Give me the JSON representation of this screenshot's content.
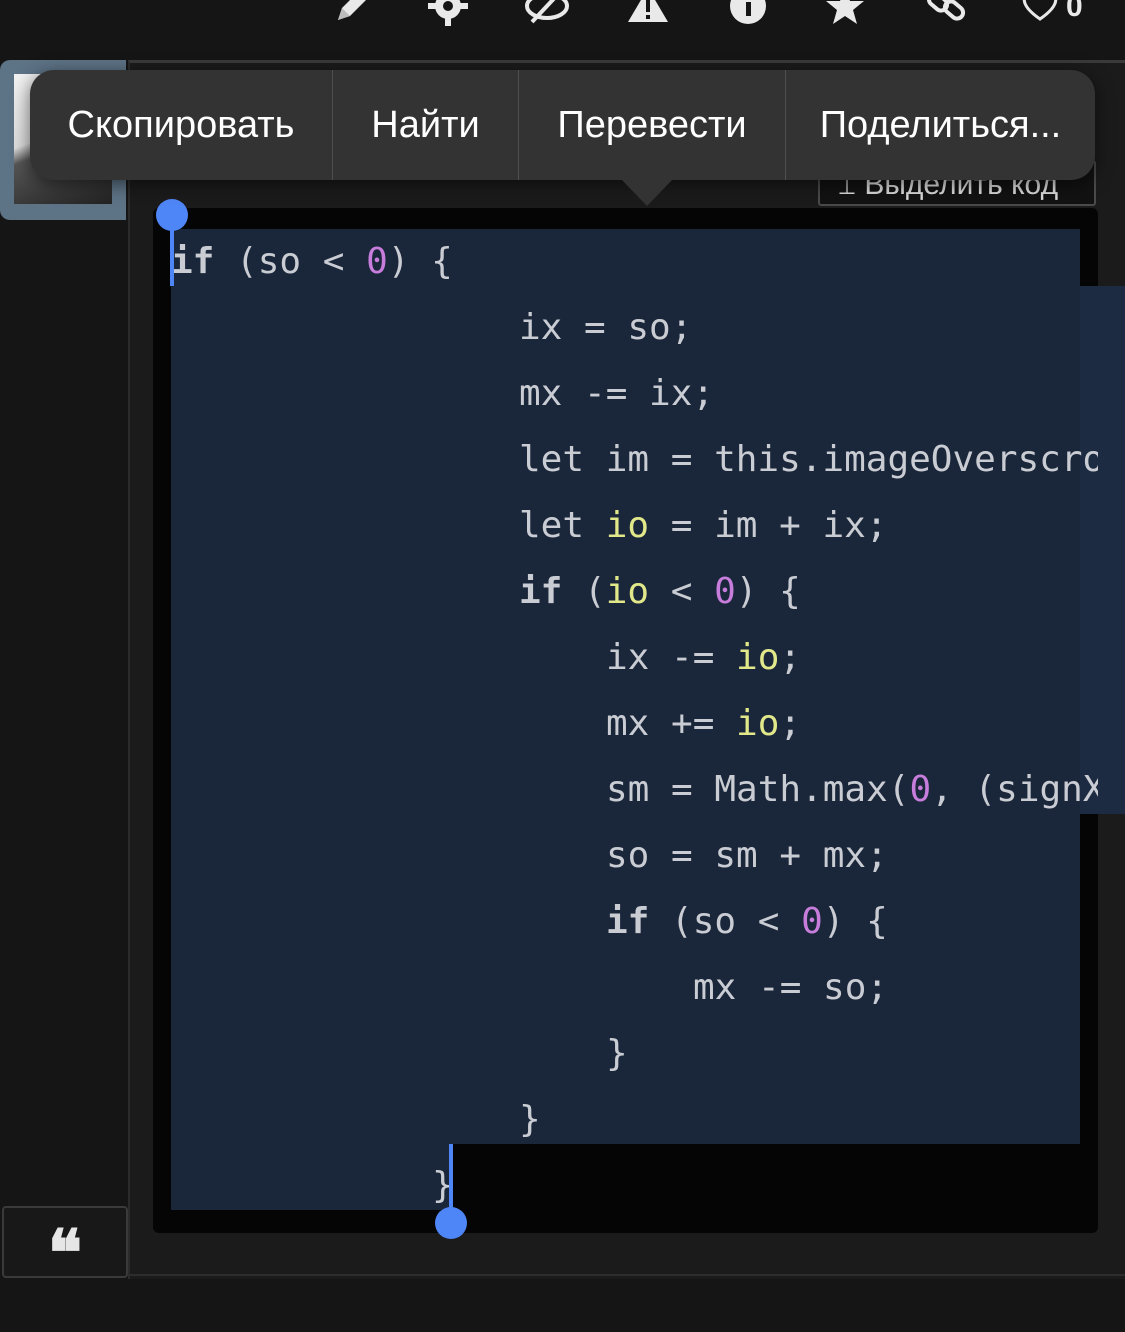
{
  "toolbar": {
    "icons": [
      "pencil-icon",
      "gear-icon",
      "eye-off-icon",
      "warning-icon",
      "info-icon",
      "star-icon",
      "link-icon",
      "heart-icon"
    ],
    "like_count": "0"
  },
  "context_menu": {
    "copy": "Скопировать",
    "find": "Найти",
    "translate": "Перевести",
    "share": "Поделиться..."
  },
  "select_code": {
    "icon": "text-cursor-icon",
    "label": "Выделить код"
  },
  "quote_button": {
    "glyph": "❝"
  },
  "code_lines": [
    "if (so < 0) {",
    "ix = so;",
    "mx -= ix;",
    "let im = this.imageOverscro",
    "let io = im + ix;",
    "if (io < 0) {",
    "ix -= io;",
    "mx += io;",
    "sm = Math.max(0, (signX",
    "so = sm + mx;",
    "if (so < 0) {",
    "mx -= so;",
    "}",
    "}",
    "}"
  ],
  "colors": {
    "selection": "#1a2639",
    "caret": "#4f86f7",
    "number": "#c77ddb",
    "variable": "#e1e88a",
    "menu_bg": "#333333"
  }
}
